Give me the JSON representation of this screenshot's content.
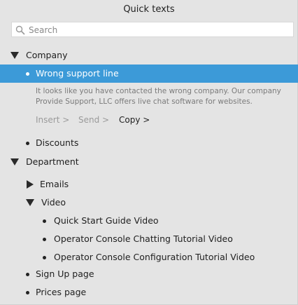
{
  "panel": {
    "title": "Quick texts",
    "search_placeholder": "Search"
  },
  "tree": {
    "company": {
      "label": "Company",
      "items": {
        "wrong_support": {
          "label": "Wrong support line",
          "text": "It looks like you have contacted the wrong company. Our company Provide Support, LLC offers live chat software for websites.",
          "actions": {
            "insert": "Insert >",
            "send": "Send >",
            "copy": "Copy >"
          }
        },
        "discounts": {
          "label": "Discounts"
        }
      }
    },
    "department": {
      "label": "Department",
      "emails": {
        "label": "Emails"
      },
      "video": {
        "label": "Video",
        "items": [
          "Quick Start Guide Video",
          "Operator Console Chatting Tutorial Video",
          "Operator Console Configuration Tutorial Video"
        ]
      },
      "sign_up": {
        "label": "Sign Up page"
      },
      "prices": {
        "label": "Prices page"
      }
    }
  },
  "colors": {
    "selected_bg": "#3c9ad8",
    "panel_bg": "#e4e4e4",
    "description_text": "#7a7a7a"
  }
}
